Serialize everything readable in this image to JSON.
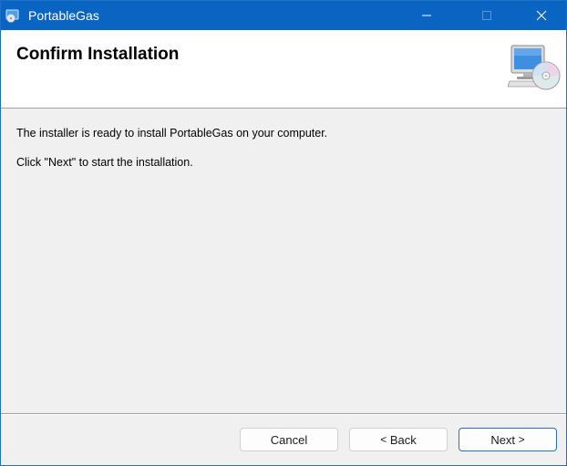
{
  "window": {
    "title": "PortableGas",
    "controls": {
      "minimize_icon": "minimize-icon",
      "maximize_icon": "maximize-icon",
      "close_icon": "close-icon"
    },
    "titlebar_color": "#0a64c2"
  },
  "header": {
    "title": "Confirm Installation",
    "icon": "computer-cd-icon"
  },
  "body": {
    "line1": "The installer is ready to install PortableGas on your computer.",
    "line2": "Click \"Next\" to start the installation."
  },
  "buttons": {
    "cancel": "Cancel",
    "back": "Back",
    "back_chevron": "<",
    "next": "Next",
    "next_chevron": ">"
  }
}
